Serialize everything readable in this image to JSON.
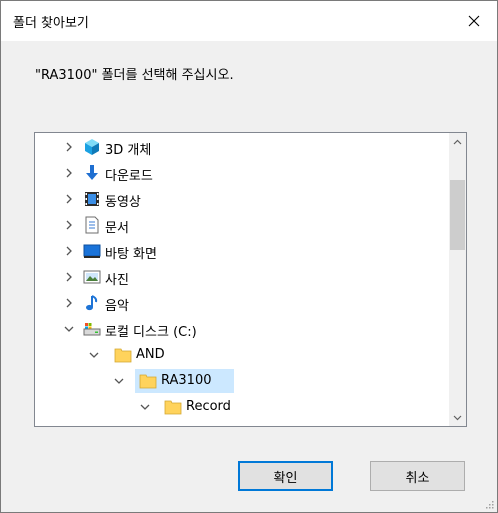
{
  "window": {
    "title": "폴더 찾아보기"
  },
  "prompt": "\"RA3100\" 폴더를 선택해 주십시오.",
  "tree": {
    "items": [
      {
        "label": "3D 개체",
        "icon": "3d-objects-icon",
        "chevron": "right"
      },
      {
        "label": "다운로드",
        "icon": "download-icon",
        "chevron": "right"
      },
      {
        "label": "동영상",
        "icon": "video-icon",
        "chevron": "right"
      },
      {
        "label": "문서",
        "icon": "document-icon",
        "chevron": "right"
      },
      {
        "label": "바탕 화면",
        "icon": "desktop-icon",
        "chevron": "right"
      },
      {
        "label": "사진",
        "icon": "picture-icon",
        "chevron": "right"
      },
      {
        "label": "음악",
        "icon": "music-icon",
        "chevron": "right"
      },
      {
        "label": "로컬 디스크 (C:)",
        "icon": "drive-icon",
        "chevron": "down"
      },
      {
        "label": "AND",
        "icon": "folder-icon",
        "chevron": "down"
      },
      {
        "label": "RA3100",
        "icon": "folder-icon",
        "chevron": "down",
        "selected": true
      },
      {
        "label": "Record",
        "icon": "folder-icon",
        "chevron": "down"
      }
    ]
  },
  "buttons": {
    "ok": "확인",
    "cancel": "취소"
  },
  "colors": {
    "selection": "#cce8ff",
    "accent": "#0078d7",
    "folder": "#ffd35c"
  }
}
